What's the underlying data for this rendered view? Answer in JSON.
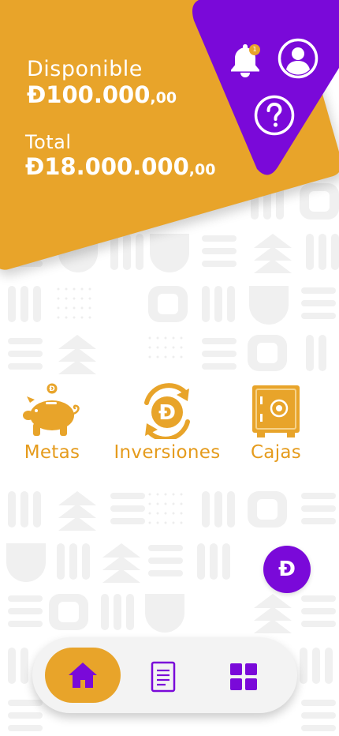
{
  "balances": {
    "available": {
      "label": "Disponible",
      "amount": "Đ100.000",
      "cents": ",00"
    },
    "total": {
      "label": "Total",
      "amount": "Đ18.000.000",
      "cents": ",00"
    }
  },
  "header": {
    "notification_icon": "bell-icon",
    "notification_count": "1",
    "profile_icon": "user-circle-icon",
    "help_icon": "question-circle-icon"
  },
  "features": [
    {
      "label": "Metas",
      "icon": "piggy-bank-icon"
    },
    {
      "label": "Inversiones",
      "icon": "currency-exchange-icon"
    },
    {
      "label": "Cajas",
      "icon": "safe-icon"
    }
  ],
  "fab": {
    "label": "Đ",
    "icon": "currency-coin-icon"
  },
  "bottom_nav": {
    "items": [
      {
        "name": "home",
        "icon": "home-icon",
        "active": true
      },
      {
        "name": "documents",
        "icon": "document-icon",
        "active": false
      },
      {
        "name": "apps",
        "icon": "grid-icon",
        "active": false
      }
    ]
  },
  "colors": {
    "gold": "#e8a42a",
    "gold_text": "#e59b1c",
    "purple": "#7a09d9",
    "white": "#ffffff",
    "pattern": "#f1f1f1"
  }
}
